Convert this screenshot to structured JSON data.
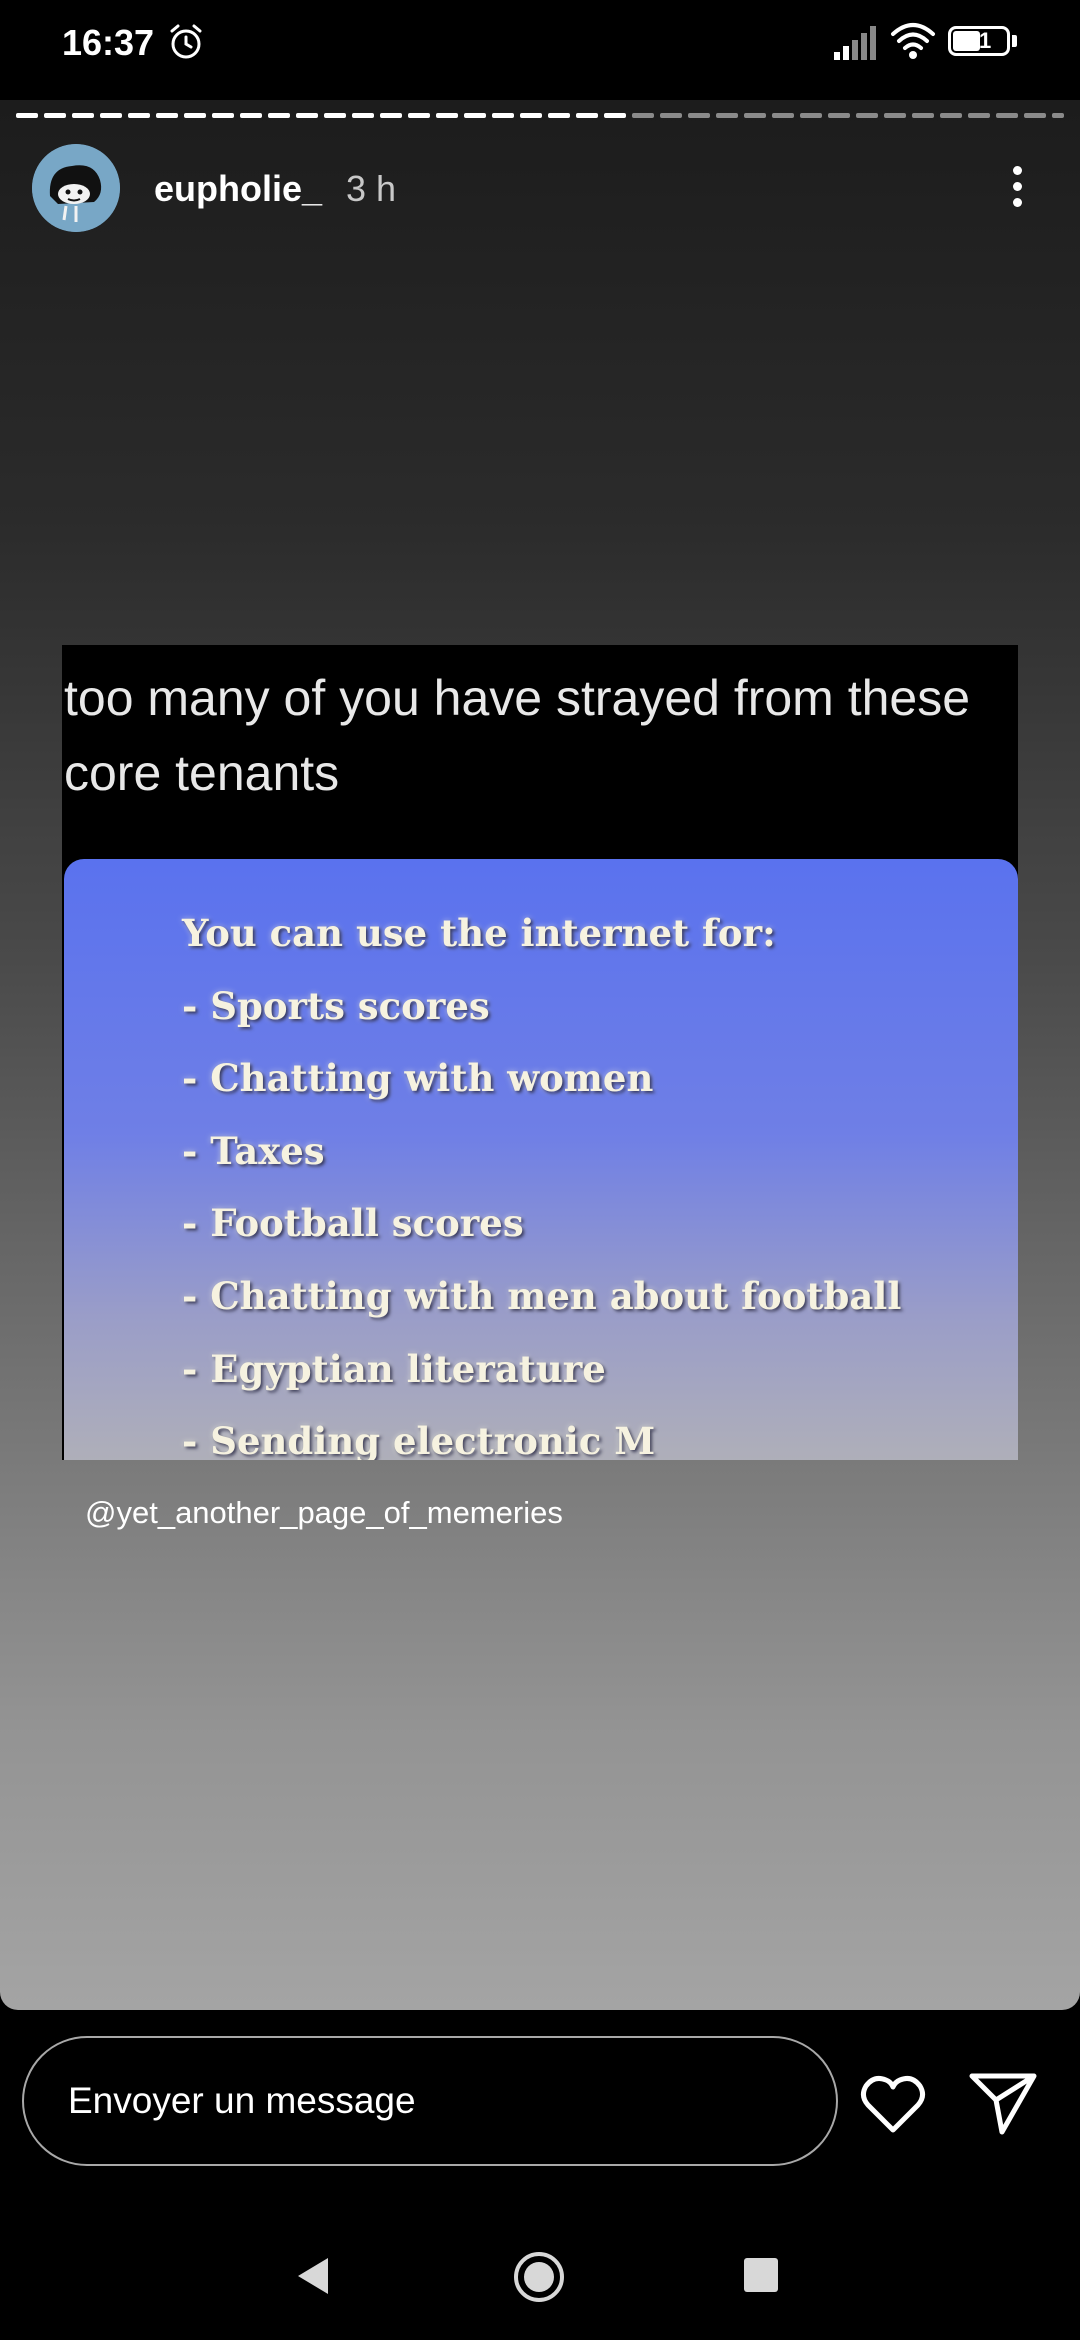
{
  "status_bar": {
    "time": "16:37",
    "battery_level": "51",
    "icons": [
      "alarm-icon",
      "signal-icon",
      "wifi-icon",
      "battery-icon"
    ]
  },
  "story": {
    "progress_fraction": 0.57,
    "username": "eupholie_",
    "time_ago": "3 h",
    "meme": {
      "caption": "too many of you have strayed from these core tenants",
      "slide_lines": [
        "You can use the internet for:",
        "- Sports scores",
        "- Chatting with women",
        "- Taxes",
        "- Football scores",
        "- Chatting with men about football",
        "- Egyptian literature",
        "- Sending electronic M"
      ]
    },
    "mention": "@yet_another_page_of_memeries"
  },
  "reply": {
    "placeholder": "Envoyer un message"
  },
  "colors": {
    "slide_top": "#5a72ee",
    "slide_bottom": "#b0b0b8",
    "avatar_bg": "#78a7c6"
  }
}
